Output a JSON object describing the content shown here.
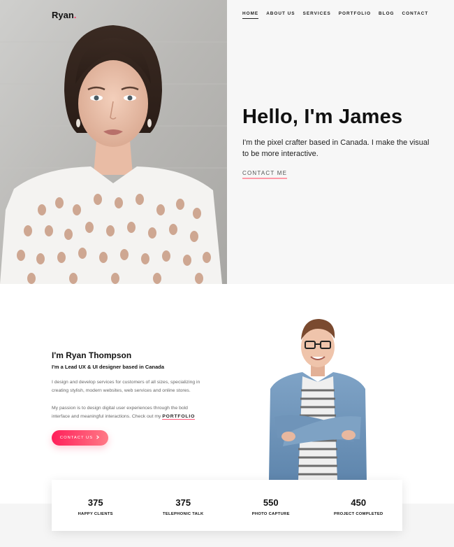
{
  "brand": {
    "name": "Ryan",
    "dot": ".",
    "accent": "#ff2e63"
  },
  "nav": {
    "items": [
      "Home",
      "About Us",
      "Services",
      "Portfolio",
      "Blog",
      "Contact"
    ],
    "active": "Home"
  },
  "hero": {
    "title": "Hello, I'm James",
    "subtitle": "I'm the pixel crafter based in Canada. I make the visual to be more interactive.",
    "cta": "Contact Me",
    "photo_icon": "woman-portrait-image"
  },
  "about": {
    "name": "I'm Ryan Thompson",
    "role": "I'm a Lead UX & UI designer based in Canada",
    "p1": "I design and develop services for customers of all sizes, specializing in creating stylish, modern websites, web services and online stores.",
    "p2_prefix": "My passion is to design digital user experiences through the bold interface and meaningful interactions. Check out my",
    "p2_link": "Portfolio",
    "button": "Contact Us",
    "button_icon": "chevron-right-icon",
    "photo_icon": "man-portrait-image"
  },
  "stats": [
    {
      "value": "375",
      "label": "Happy Clients"
    },
    {
      "value": "375",
      "label": "Telephonic Talk"
    },
    {
      "value": "550",
      "label": "Photo Capture"
    },
    {
      "value": "450",
      "label": "Project Completed"
    }
  ]
}
